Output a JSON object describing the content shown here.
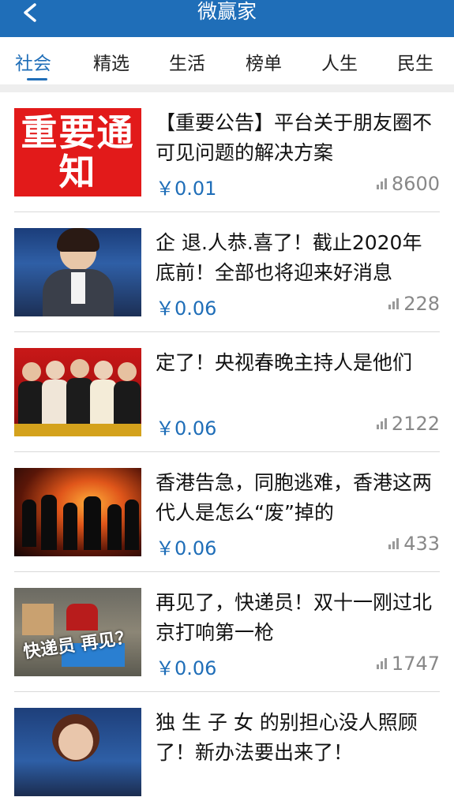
{
  "header": {
    "title": "微赢家",
    "back_icon": "chevron-left-icon"
  },
  "tabs": [
    {
      "label": "社会",
      "active": true
    },
    {
      "label": "精选",
      "active": false
    },
    {
      "label": "生活",
      "active": false
    },
    {
      "label": "榜单",
      "active": false
    },
    {
      "label": "人生",
      "active": false
    },
    {
      "label": "民生",
      "active": false
    }
  ],
  "colors": {
    "accent": "#1f6eb8",
    "notice_red": "#e21a1a"
  },
  "articles": [
    {
      "title": "【重要公告】平台关于朋友圈不可见问题的解决方案",
      "price": "￥0.01",
      "views": "8600",
      "thumb_text": "重要通知"
    },
    {
      "title": "企 退.人恭.喜了！截止2020年底前！全部也将迎来好消息",
      "price": "￥0.06",
      "views": "228"
    },
    {
      "title": "定了！央视春晚主持人是他们",
      "price": "￥0.06",
      "views": "2122"
    },
    {
      "title": "香港告急，同胞逃难，香港这两代人是怎么“废”掉的",
      "price": "￥0.06",
      "views": "433"
    },
    {
      "title": "再见了，快递员！双十一刚过北京打响第一枪",
      "price": "￥0.06",
      "views": "1747",
      "thumb_text": "快递员 再见？"
    },
    {
      "title": "独 生 子 女 的别担心没人照顾了！新办法要出来了！",
      "price": "",
      "views": ""
    }
  ]
}
